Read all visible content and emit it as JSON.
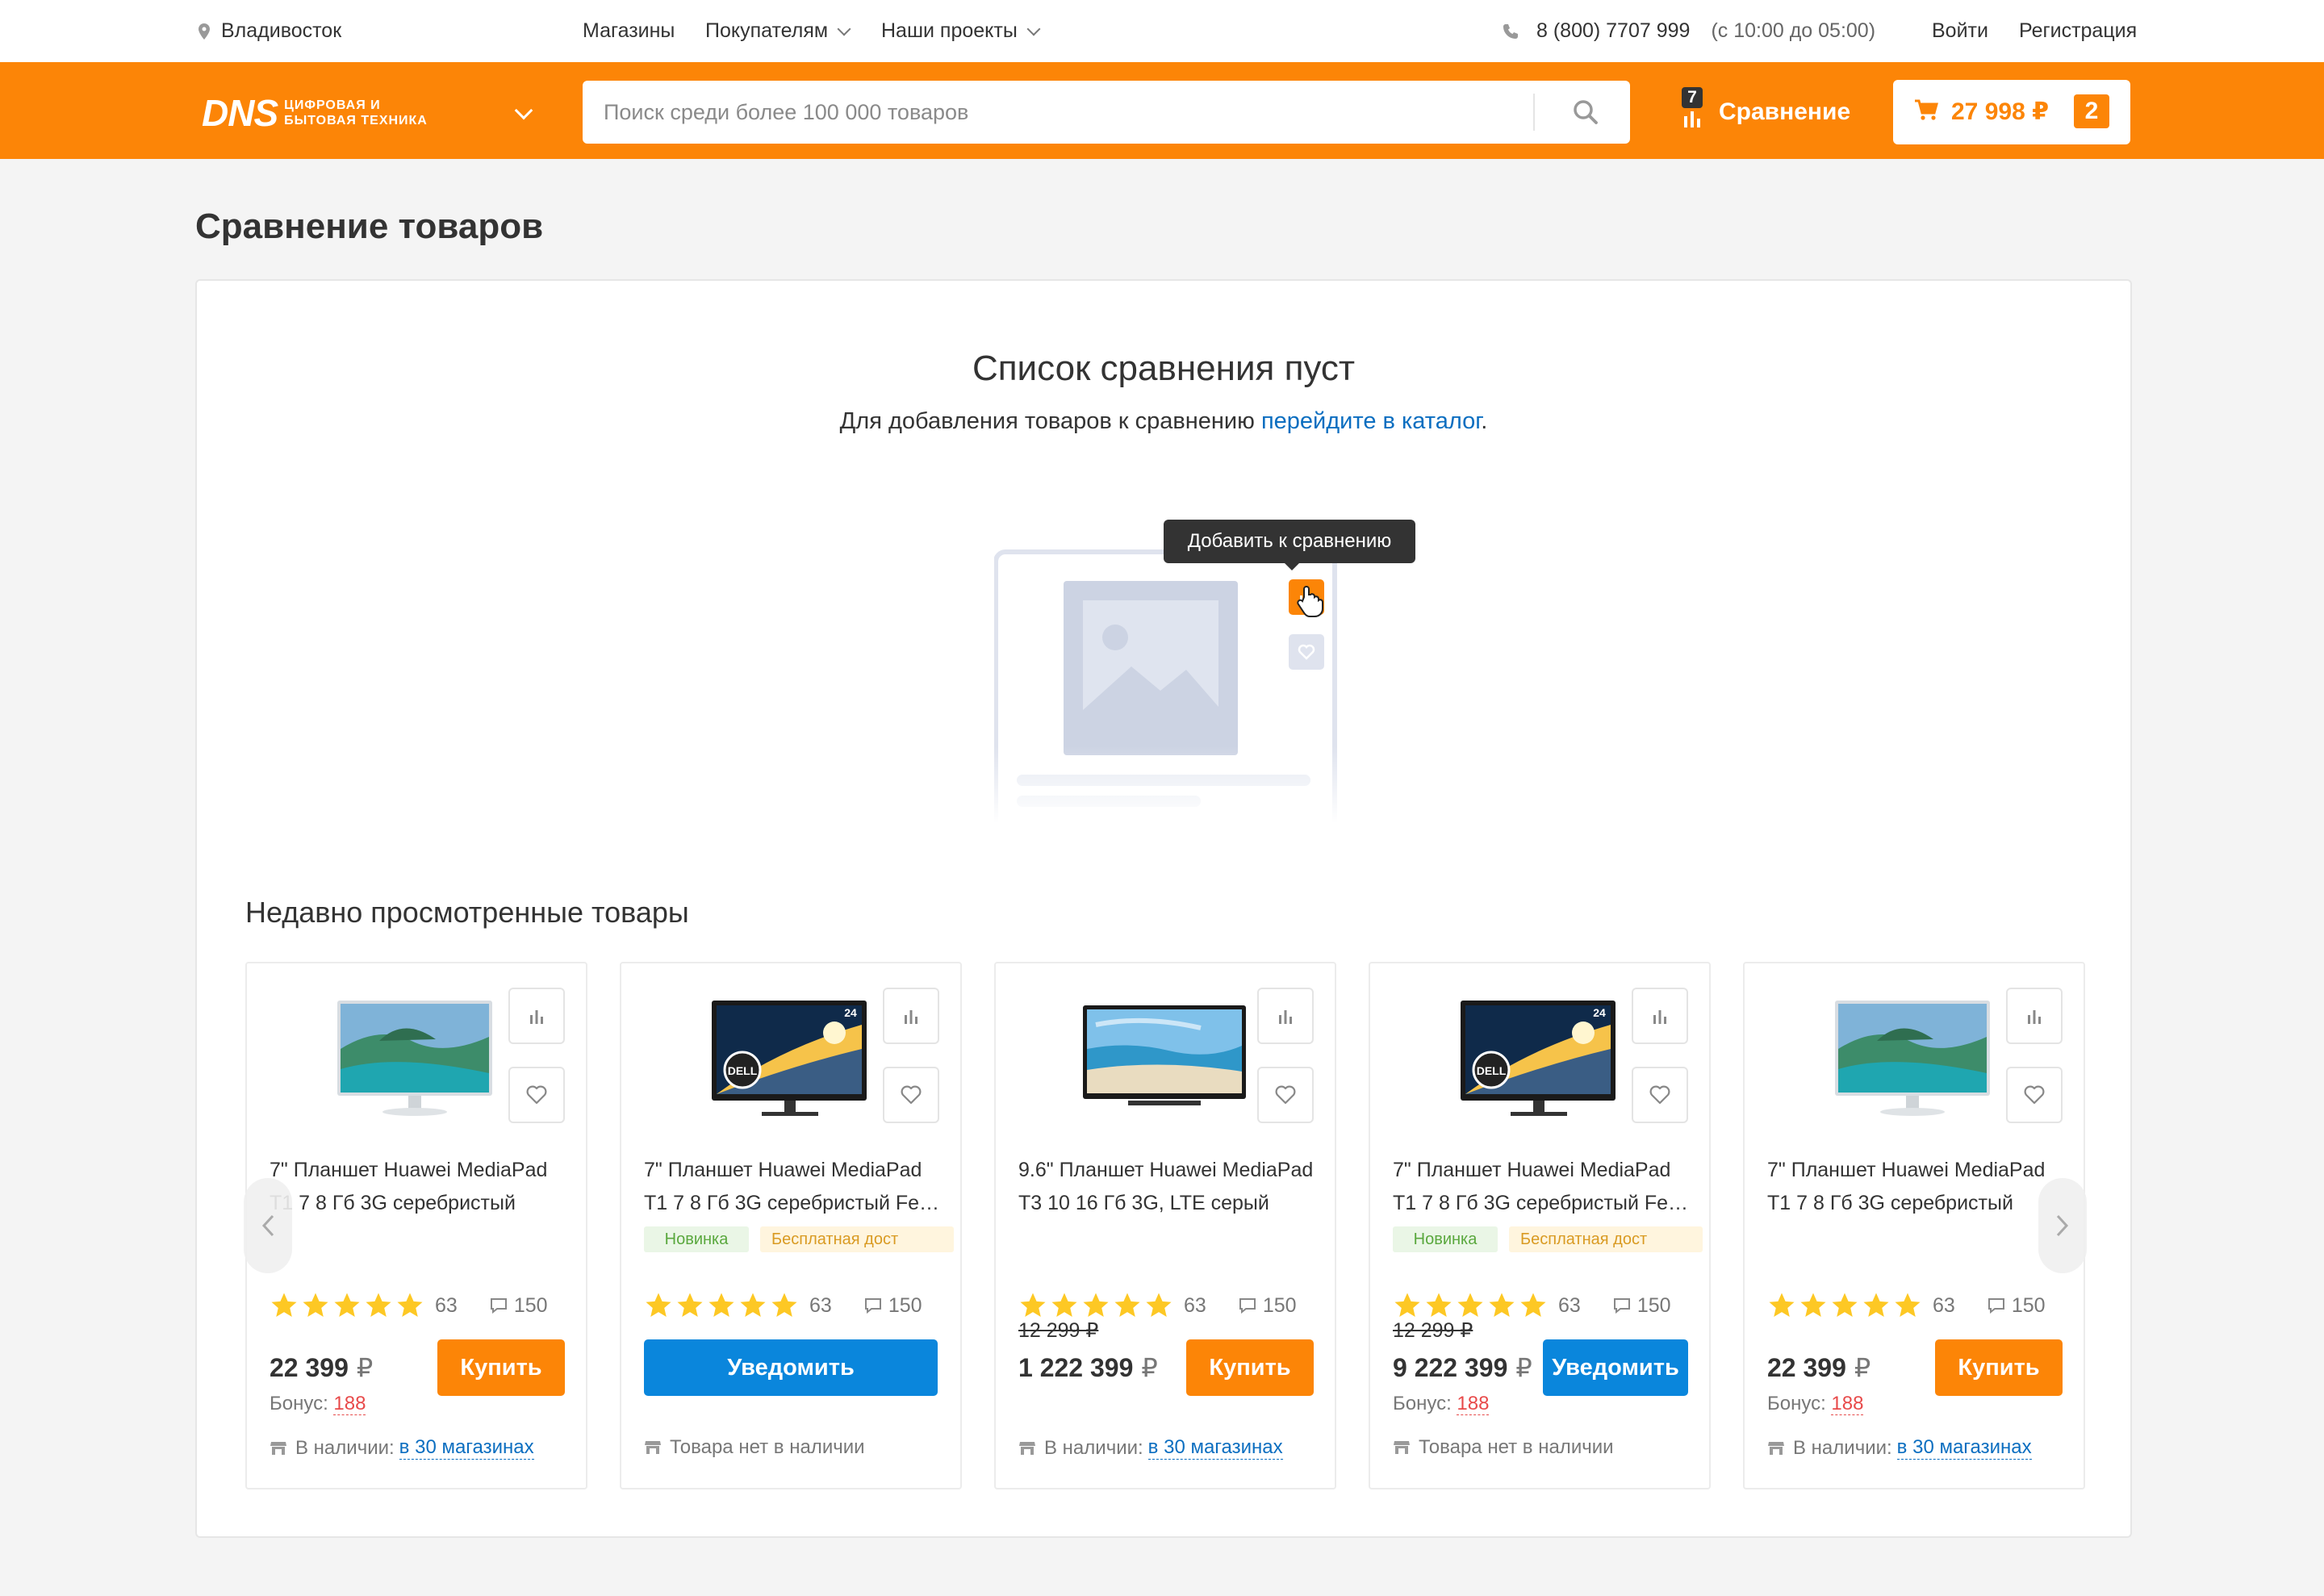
{
  "topbar": {
    "city": "Владивосток",
    "nav": [
      "Магазины",
      "Покупателям",
      "Наши проекты"
    ],
    "phone": "8 (800) 7707 999",
    "hours": "(с 10:00 до 05:00)",
    "login": "Войти",
    "register": "Регистрация"
  },
  "header": {
    "logo_main": "DNS",
    "logo_sub_1": "ЦИФРОВАЯ И",
    "logo_sub_2": "БЫТОВАЯ ТЕХНИКА",
    "search_placeholder": "Поиск среди более 100 000 товаров",
    "compare_label": "Сравнение",
    "compare_count": "7",
    "cart_sum": "27 998 ₽",
    "cart_count": "2",
    "accent": "#fc8507"
  },
  "page": {
    "title": "Сравнение товаров",
    "empty_title": "Список сравнения пуст",
    "empty_text": "Для добавления товаров к сравнению ",
    "empty_link": "перейдите в каталог",
    "empty_end": ".",
    "tooltip": "Добавить к сравнению",
    "recent_title": "Недавно просмотренные товары"
  },
  "products": [
    {
      "name1": "7\" Планшет Huawei MediaPad",
      "name2": "T1 7 8 Гб 3G серебристый",
      "rating": "63",
      "reviews": "150",
      "old_price": "",
      "price": "22 399",
      "currency": "₽",
      "button": "Купить",
      "bonus_label": "Бонус:",
      "bonus": "188",
      "stock_label": "В наличии:",
      "stock_link": "в 30 магазинах",
      "tag_new": "",
      "tag_free": ""
    },
    {
      "name1": "7\" Планшет Huawei MediaPad",
      "name2": "T1 7 8 Гб 3G серебристый Feq...",
      "rating": "63",
      "reviews": "150",
      "old_price": "",
      "price": "",
      "currency": "",
      "button": "Уведомить",
      "bonus_label": "",
      "bonus": "",
      "stock_label": "Товара нет в наличии",
      "stock_link": "",
      "tag_new": "Новинка",
      "tag_free": "Бесплатная дост"
    },
    {
      "name1": "9.6\" Планшет Huawei MediaPad",
      "name2": "T3 10 16 Гб 3G, LTE серый",
      "rating": "63",
      "reviews": "150",
      "old_price": "12 299 ₽",
      "price": "1 222 399",
      "currency": "₽",
      "button": "Купить",
      "bonus_label": "",
      "bonus": "",
      "stock_label": "В наличии:",
      "stock_link": "в 30 магазинах",
      "tag_new": "",
      "tag_free": ""
    },
    {
      "name1": "7\" Планшет Huawei MediaPad",
      "name2": "T1 7 8 Гб 3G серебристый Feq...",
      "rating": "63",
      "reviews": "150",
      "old_price": "12 299 ₽",
      "price": "9 222 399",
      "currency": "₽",
      "button": "Уведомить",
      "bonus_label": "Бонус:",
      "bonus": "188",
      "stock_label": "Товара нет в наличии",
      "stock_link": "",
      "tag_new": "Новинка",
      "tag_free": "Бесплатная дост"
    },
    {
      "name1": "7\" Планшет Huawei MediaPad",
      "name2": "T1 7 8 Гб 3G серебристый",
      "rating": "63",
      "reviews": "150",
      "old_price": "",
      "price": "22 399",
      "currency": "₽",
      "button": "Купить",
      "bonus_label": "Бонус:",
      "bonus": "188",
      "stock_label": "В наличии:",
      "stock_link": "в 30 магазинах",
      "tag_new": "",
      "tag_free": ""
    }
  ]
}
